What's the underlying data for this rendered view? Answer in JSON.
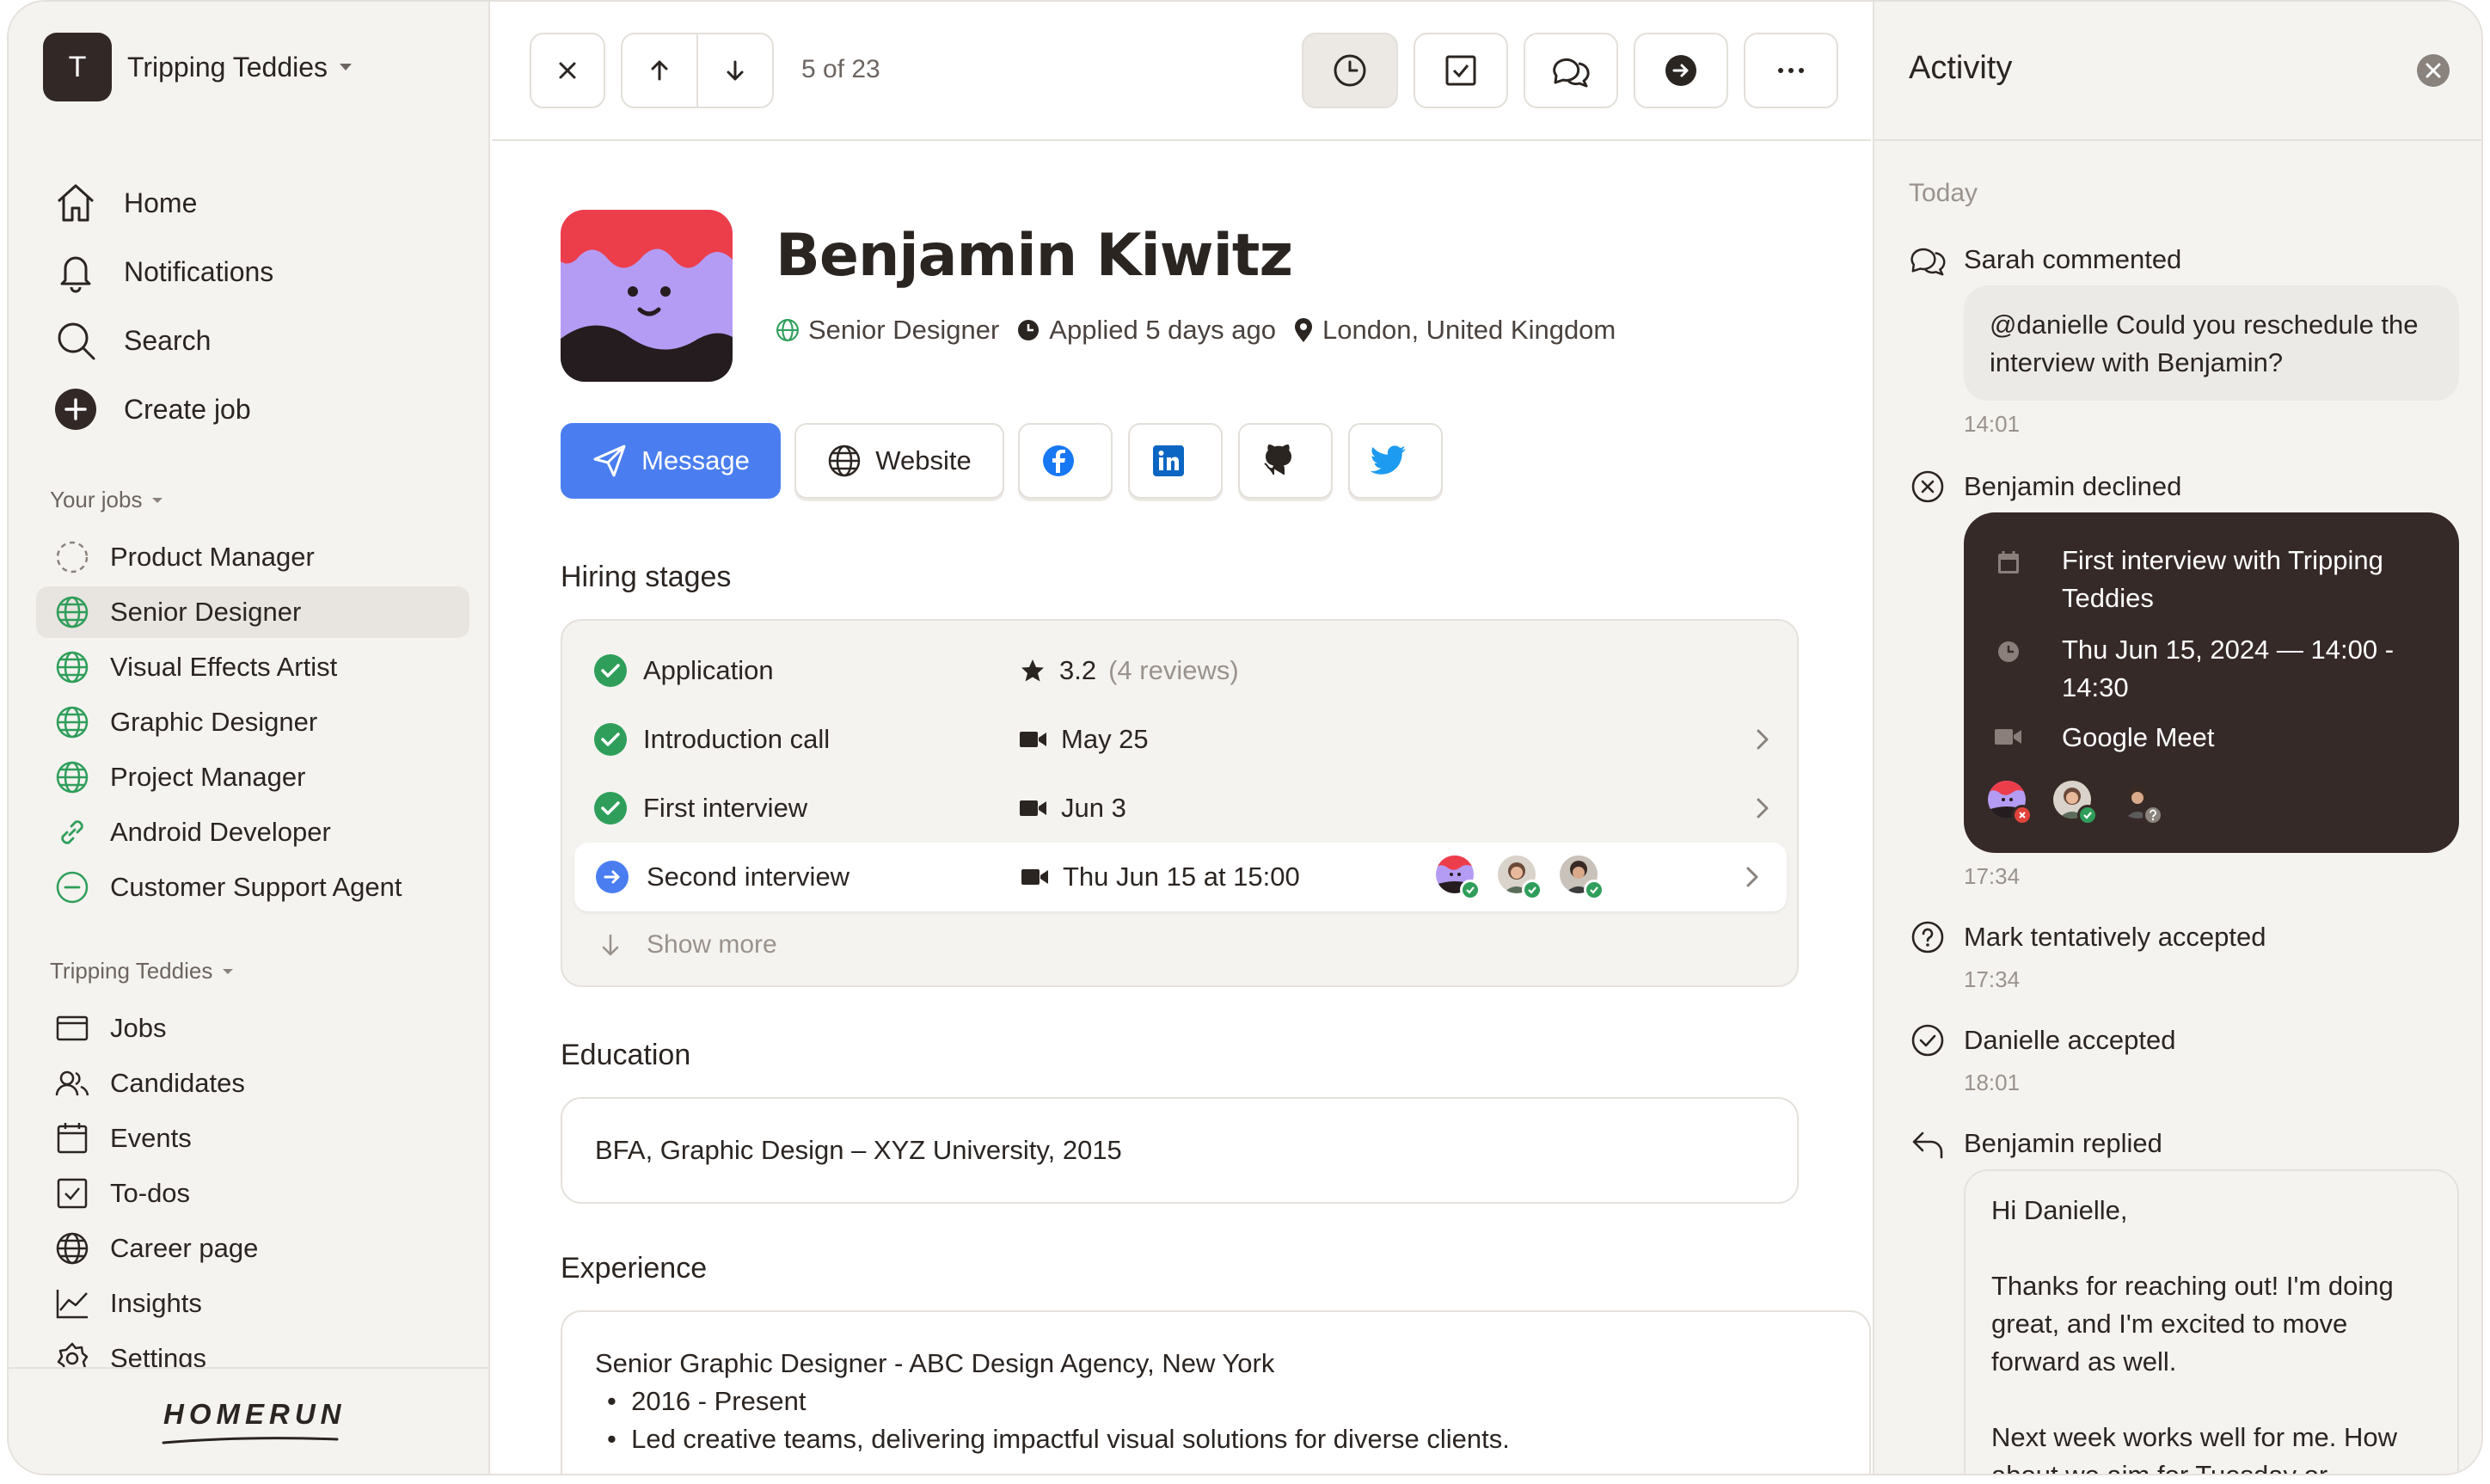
{
  "workspace": {
    "initial": "T",
    "name": "Tripping Teddies"
  },
  "nav": [
    {
      "label": "Home",
      "icon": "home-icon"
    },
    {
      "label": "Notifications",
      "icon": "bell-icon"
    },
    {
      "label": "Search",
      "icon": "search-icon"
    },
    {
      "label": "Create job",
      "icon": "plus-circle-icon"
    }
  ],
  "your_jobs": {
    "title": "Your jobs",
    "items": [
      {
        "label": "Product Manager",
        "icon": "draft-icon"
      },
      {
        "label": "Senior Designer",
        "icon": "globe-icon",
        "selected": true
      },
      {
        "label": "Visual Effects Artist",
        "icon": "globe-icon"
      },
      {
        "label": "Graphic Designer",
        "icon": "globe-icon"
      },
      {
        "label": "Project Manager",
        "icon": "globe-icon"
      },
      {
        "label": "Android Developer",
        "icon": "link-icon"
      },
      {
        "label": "Customer Support Agent",
        "icon": "minus-circle-icon"
      }
    ]
  },
  "org": {
    "title": "Tripping Teddies",
    "items": [
      {
        "label": "Jobs",
        "icon": "jobs-icon"
      },
      {
        "label": "Candidates",
        "icon": "candidates-icon"
      },
      {
        "label": "Events",
        "icon": "calendar-icon"
      },
      {
        "label": "To-dos",
        "icon": "checkbox-icon"
      },
      {
        "label": "Career page",
        "icon": "globe-icon"
      },
      {
        "label": "Insights",
        "icon": "chart-icon"
      },
      {
        "label": "Settings",
        "icon": "gear-icon"
      }
    ]
  },
  "brand": "HOMERUN",
  "toolbar": {
    "counter": "5 of 23"
  },
  "candidate": {
    "name": "Benjamin Kiwitz",
    "role": "Senior Designer",
    "applied": "Applied 5 days ago",
    "location": "London, United Kingdom"
  },
  "actions": {
    "message": "Message",
    "website": "Website"
  },
  "hiring": {
    "title": "Hiring stages",
    "stages": [
      {
        "name": "Application",
        "info": "3.2",
        "extra": "(4 reviews)"
      },
      {
        "name": "Introduction call",
        "info": "May 25"
      },
      {
        "name": "First interview",
        "info": "Jun 3"
      },
      {
        "name": "Second interview",
        "info": "Thu Jun 15 at 15:00"
      }
    ],
    "show_more": "Show more"
  },
  "education": {
    "title": "Education",
    "entry": "BFA, Graphic Design – XYZ University, 2015"
  },
  "experience": {
    "title": "Experience",
    "role": "Senior Graphic Designer - ABC Design Agency, New York",
    "bullets": [
      "2016 - Present",
      "Led creative teams, delivering impactful visual solutions for diverse clients."
    ]
  },
  "activity": {
    "title": "Activity",
    "day": "Today",
    "comment": {
      "author": "Sarah commented",
      "text": "@danielle Could you reschedule the interview with Benjamin?",
      "time": "14:01"
    },
    "declined": {
      "label": "Benjamin declined",
      "event_title": "First interview with Tripping Teddies",
      "event_time": "Thu Jun 15, 2024 — 14:00 - 14:30",
      "event_place": "Google Meet",
      "time": "17:34"
    },
    "tentative": {
      "label": "Mark tentatively accepted",
      "time": "17:34"
    },
    "accepted": {
      "label": "Danielle accepted",
      "time": "18:01"
    },
    "replied": {
      "label": "Benjamin replied",
      "greeting": "Hi Danielle,",
      "p1": "Thanks for reaching out! I'm doing great, and I'm excited to move forward as well.",
      "p2": "Next week works well for me. How about we aim for Tuesday or"
    }
  },
  "colors": {
    "accent": "#4a7ef0",
    "success": "#2f9e5a",
    "dark_card": "#362a28",
    "declined": "#e0433a"
  }
}
